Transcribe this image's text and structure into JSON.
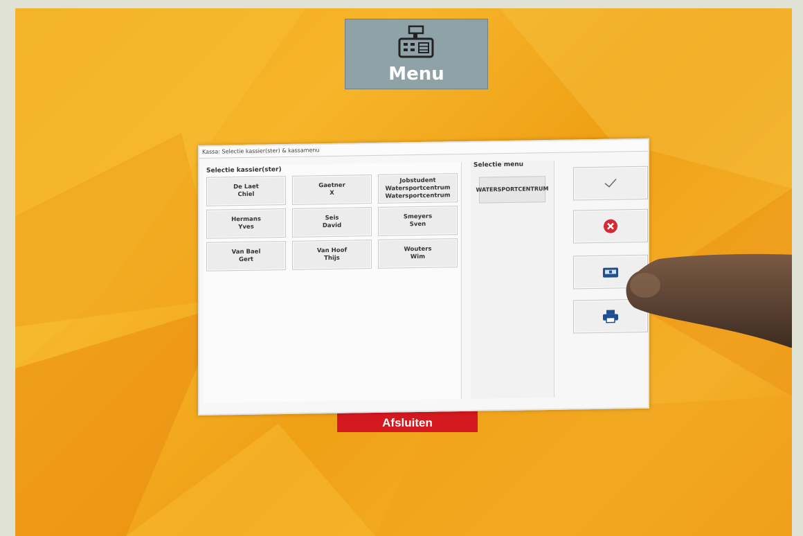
{
  "background_screen": {
    "menu_tile_label": "Menu",
    "close_tile_label": "Afsluiten"
  },
  "dialog": {
    "title": "Kassa: Selectie kassier(ster) & kassamenu",
    "cashiers_section_label": "Selectie kassier(ster)",
    "cashiers": [
      {
        "line1": "De Laet",
        "line2": "Chiel",
        "line3": ""
      },
      {
        "line1": "Gaetner",
        "line2": "X",
        "line3": ""
      },
      {
        "line1": "Jobstudent",
        "line2": "Watersportcentrum",
        "line3": "Watersportcentrum"
      },
      {
        "line1": "Hermans",
        "line2": "Yves",
        "line3": ""
      },
      {
        "line1": "Seis",
        "line2": "David",
        "line3": ""
      },
      {
        "line1": "Smeyers",
        "line2": "Sven",
        "line3": ""
      },
      {
        "line1": "Van Bael",
        "line2": "Gert",
        "line3": ""
      },
      {
        "line1": "Van Hoof",
        "line2": "Thijs",
        "line3": ""
      },
      {
        "line1": "Wouters",
        "line2": "Wim",
        "line3": ""
      }
    ],
    "menu_section_label": "Selectie menu",
    "menu_options": [
      {
        "label": "WATERSPORTCENTRUM"
      }
    ],
    "action_buttons": [
      {
        "icon": "checkmark-icon"
      },
      {
        "icon": "cancel-icon"
      },
      {
        "icon": "cash-register-icon"
      },
      {
        "icon": "printer-icon"
      }
    ]
  },
  "colors": {
    "background_orange": "#f2a91c",
    "menu_tile": "#8fa2a8",
    "close_tile": "#d4181f",
    "cancel_red": "#d42a33",
    "icon_blue": "#1f4f8f"
  }
}
